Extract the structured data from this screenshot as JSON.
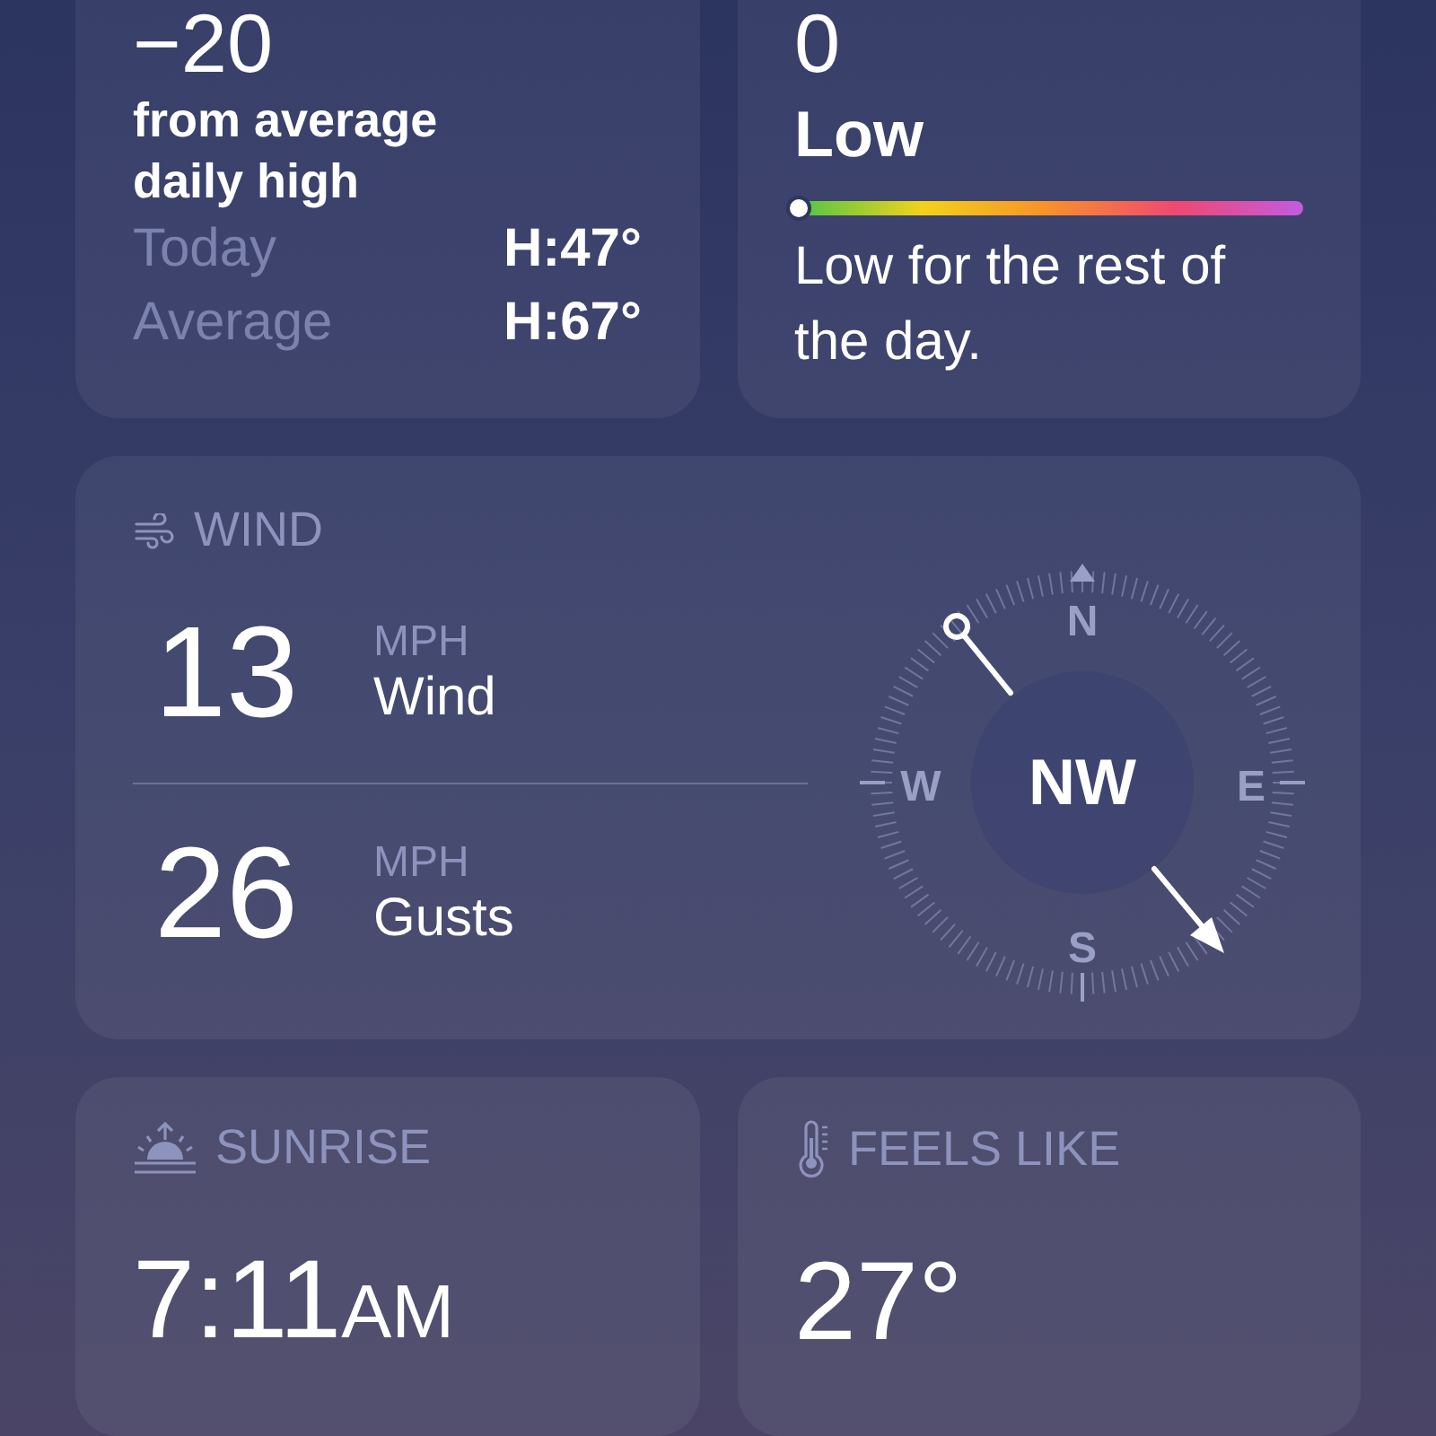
{
  "temperature_card": {
    "value": "−20",
    "caption": "from average daily high",
    "rows": [
      {
        "label": "Today",
        "value": "H:47°"
      },
      {
        "label": "Average",
        "value": "H:67°"
      }
    ]
  },
  "uv_card": {
    "value": "0",
    "level_text": "Low",
    "level": 0,
    "description": "Low for the rest of the day."
  },
  "wind_card": {
    "title": "WIND",
    "readings": [
      {
        "value": "13",
        "unit": "MPH",
        "label": "Wind"
      },
      {
        "value": "26",
        "unit": "MPH",
        "label": "Gusts"
      }
    ],
    "compass": {
      "direction": "NW",
      "north": "N",
      "east": "E",
      "south": "S",
      "west": "W"
    }
  },
  "sunrise_card": {
    "title": "SUNRISE",
    "time": "7:11",
    "suffix": "AM"
  },
  "feels_like_card": {
    "title": "FEELS LIKE",
    "value": "27°"
  }
}
